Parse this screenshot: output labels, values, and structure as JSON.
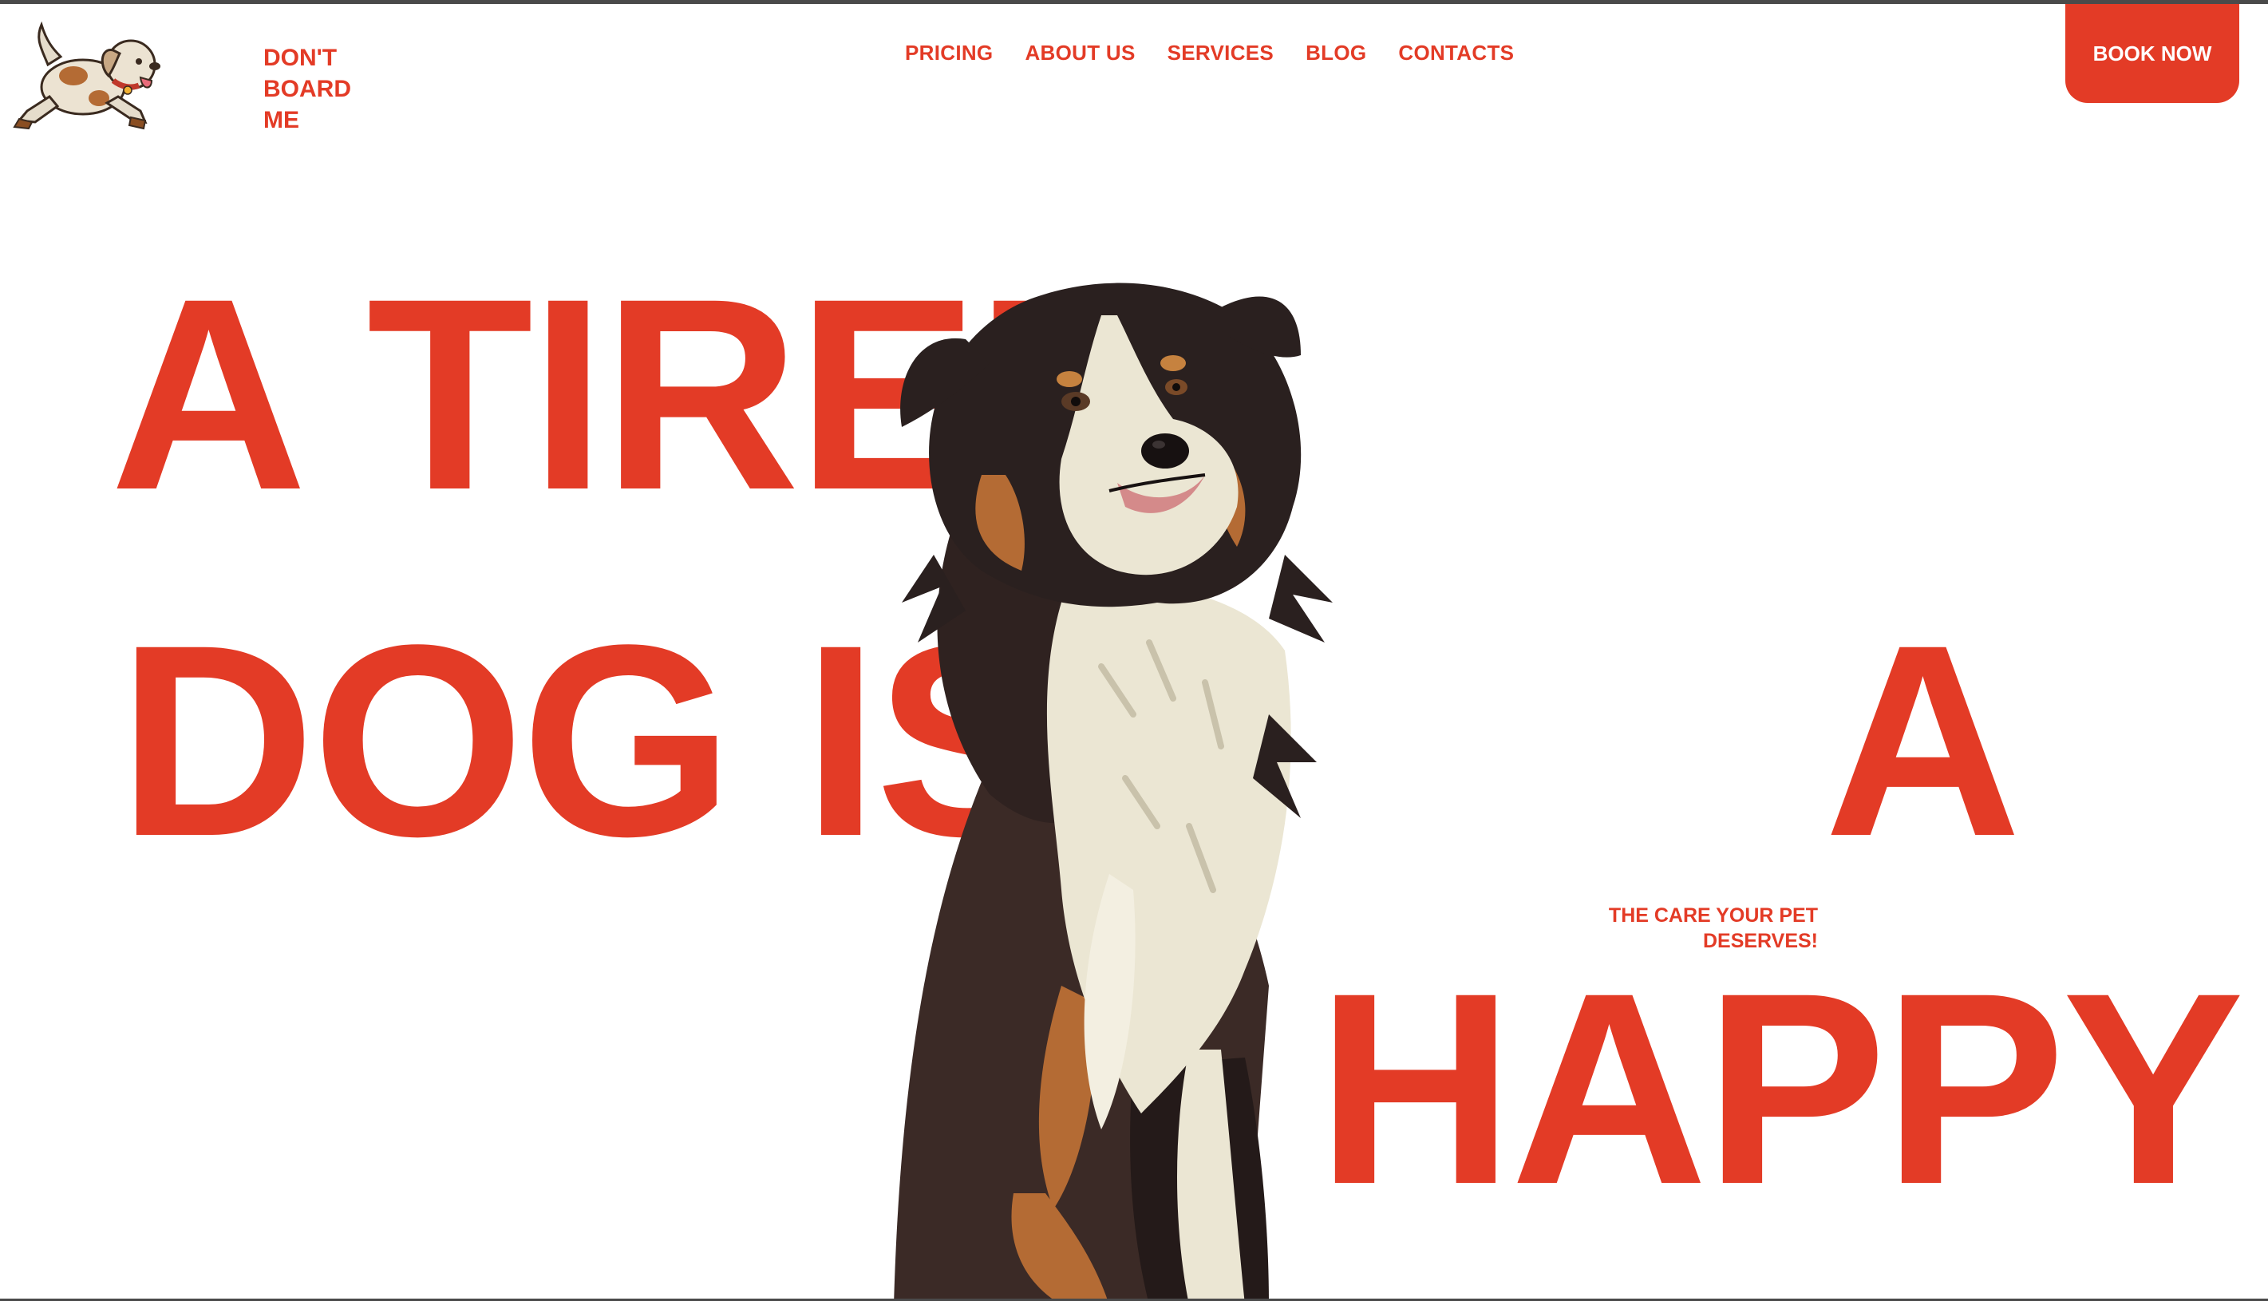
{
  "header": {
    "brand_lines": [
      "DON'T",
      "BOARD",
      "ME"
    ],
    "logo_icon": "running-puppy-logo",
    "nav": [
      {
        "label": "PRICING"
      },
      {
        "label": "ABOUT US"
      },
      {
        "label": "SERVICES"
      },
      {
        "label": "BLOG"
      },
      {
        "label": "CONTACTS"
      }
    ],
    "cta_label": "BOOK NOW"
  },
  "hero": {
    "line1": "A TIRED",
    "line2": "DOG IS",
    "line3": "A",
    "line4": "HAPPY",
    "tagline": "THE CARE YOUR PET DESERVES!",
    "image_icon": "australian-shepherd-dog-illustration"
  },
  "colors": {
    "accent": "#e33b26",
    "background": "#ffffff",
    "text_on_accent": "#ffffff"
  }
}
